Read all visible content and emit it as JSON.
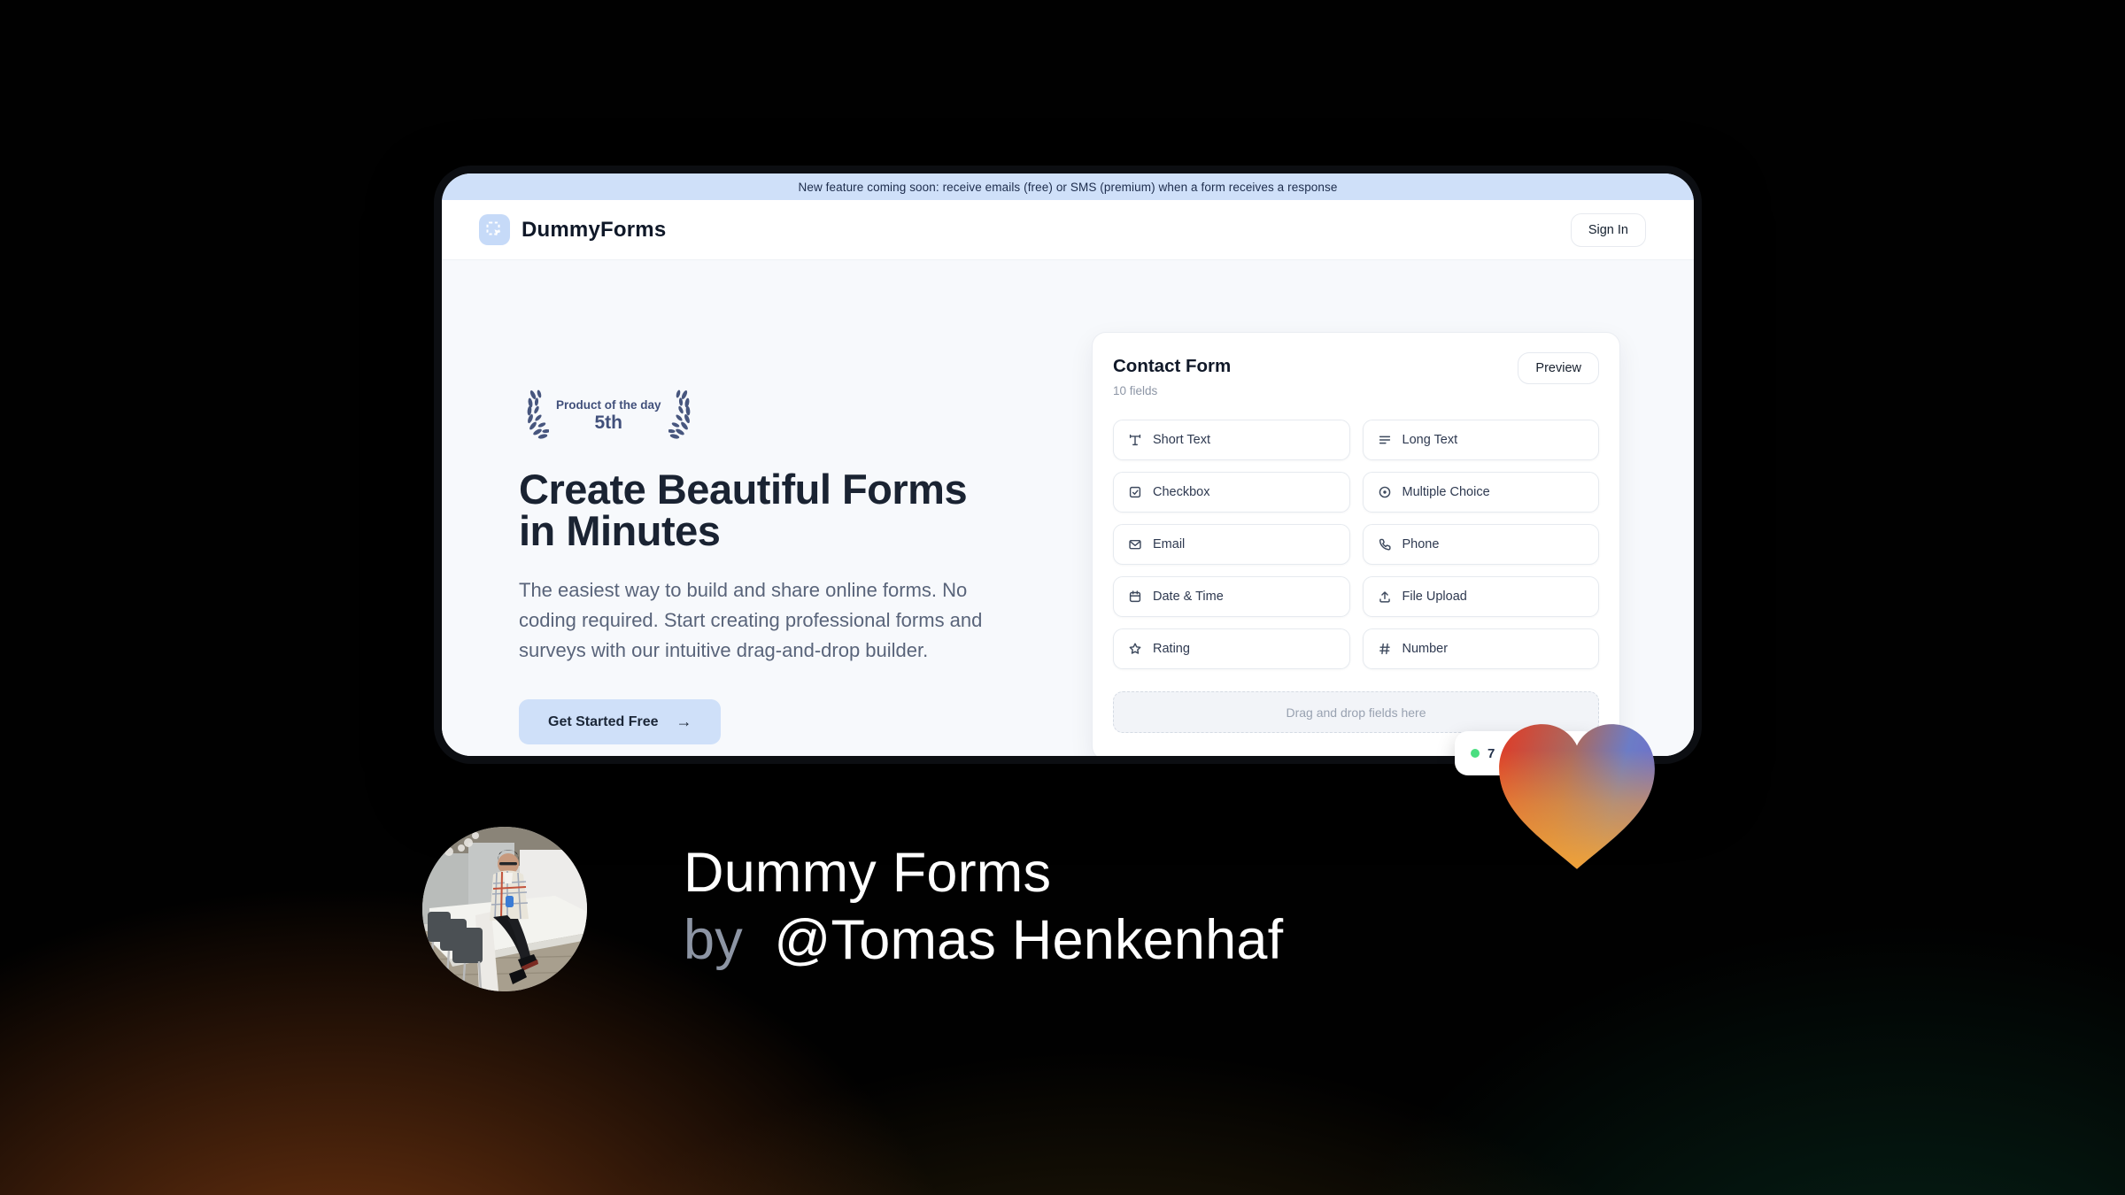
{
  "announcement": {
    "text": "New feature coming soon: receive emails (free) or SMS (premium) when a form receives a response"
  },
  "header": {
    "brand": "DummyForms",
    "sign_in_label": "Sign In"
  },
  "hero": {
    "award_line1": "Product of the day",
    "award_line2": "5th",
    "title": "Create Beautiful Forms in Minutes",
    "description": "The easiest way to build and share online forms. No coding required. Start creating professional forms and surveys with our intuitive drag-and-drop builder.",
    "cta_label": "Get Started Free",
    "cta_arrow": "→"
  },
  "form_card": {
    "title": "Contact Form",
    "subtitle": "10 fields",
    "preview_label": "Preview",
    "fields": [
      {
        "icon": "short-text",
        "label": "Short Text"
      },
      {
        "icon": "long-text",
        "label": "Long Text"
      },
      {
        "icon": "checkbox",
        "label": "Checkbox"
      },
      {
        "icon": "multiple-choice",
        "label": "Multiple Choice"
      },
      {
        "icon": "email",
        "label": "Email"
      },
      {
        "icon": "phone",
        "label": "Phone"
      },
      {
        "icon": "date-time",
        "label": "Date & Time"
      },
      {
        "icon": "file-upload",
        "label": "File Upload"
      },
      {
        "icon": "rating",
        "label": "Rating"
      },
      {
        "icon": "number",
        "label": "Number"
      }
    ],
    "dropzone_text": "Drag and drop fields here"
  },
  "visitor_badge": {
    "text": "7"
  },
  "caption": {
    "line1": "Dummy Forms",
    "by": "by",
    "handle": "@Tomas Henkenhaf"
  },
  "colors": {
    "accent_light_blue": "#cfe0f9",
    "brand_navy": "#101828",
    "body_bg": "#f7f9fc",
    "badge_green": "#4ade80",
    "heart_red": "#e23a24",
    "heart_orange": "#f5a030",
    "heart_blue": "#6c7cc6",
    "laurel_slate": "#41507b"
  }
}
